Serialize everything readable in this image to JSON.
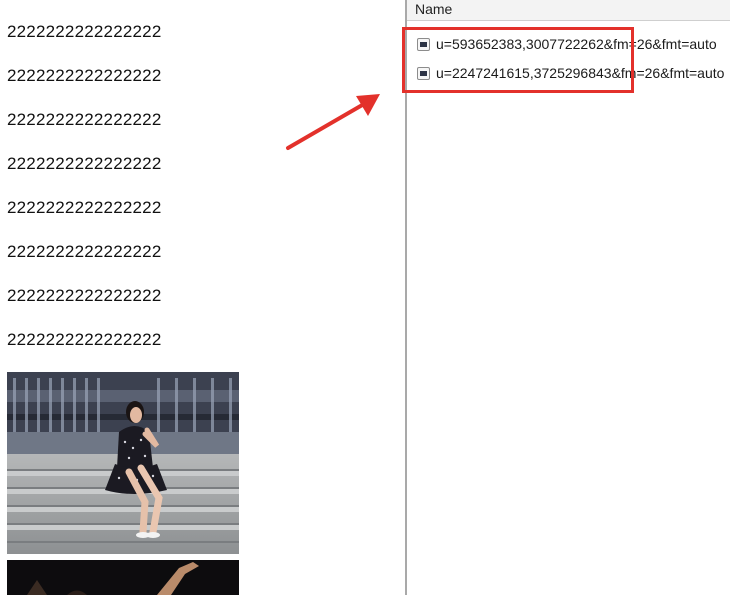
{
  "left_page": {
    "lines": [
      "2222222222222222",
      "2222222222222222",
      "2222222222222222",
      "2222222222222222",
      "2222222222222222",
      "2222222222222222",
      "2222222222222222",
      "2222222222222222"
    ]
  },
  "network_panel": {
    "column_header": "Name",
    "requests": [
      {
        "name": "u=593652383,3007722262&fm=26&fmt=auto"
      },
      {
        "name": "u=2247241615,3725296843&fm=26&fmt=auto"
      }
    ]
  },
  "colors": {
    "annotation_red": "#e3312b",
    "divider": "#a9a9a9",
    "header_bg": "#f3f3f3"
  },
  "icons": {
    "request_file": "image-file-icon",
    "annotation_arrow": "red-arrow-icon"
  }
}
